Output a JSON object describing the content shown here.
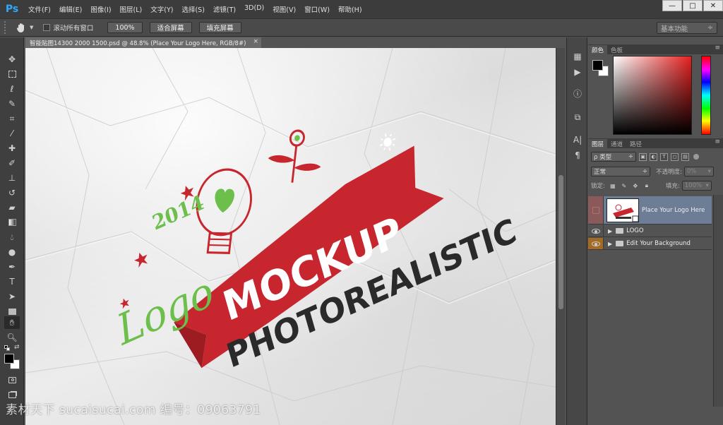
{
  "app": {
    "logo": "Ps",
    "menu": [
      "文件(F)",
      "编辑(E)",
      "图像(I)",
      "图层(L)",
      "文字(Y)",
      "选择(S)",
      "滤镜(T)",
      "3D(D)",
      "视图(V)",
      "窗口(W)",
      "帮助(H)"
    ],
    "window_controls": [
      "—",
      "□",
      "✕"
    ]
  },
  "options_bar": {
    "scroll_all_label": "滚动所有窗口",
    "zoom_100": "100%",
    "fit_screen": "适合屏幕",
    "fill_screen": "填充屏幕",
    "workspace": "基本功能"
  },
  "document": {
    "tab_title": "智能贴图14300 2000 1500.psd @ 48.8% (Place Your Logo Here, RGB/8#)",
    "close": "×",
    "artwork": {
      "year": "2014",
      "script_word": "Logo",
      "banner_word": "MOCKUP",
      "tagline": "PHOTOREALISTIC",
      "colors": {
        "red": "#c8262e",
        "green": "#6cbf4a",
        "dark": "#2a2a2a"
      }
    }
  },
  "panels": {
    "color_tabs": [
      "颜色",
      "色板"
    ],
    "layers_tabs": [
      "图层",
      "通道",
      "路径"
    ],
    "filter_kind": "ρ 类型",
    "blend_mode": "正常",
    "opacity_label": "不透明度:",
    "opacity_value": "0%",
    "lock_label": "锁定:",
    "fill_label": "填充:",
    "fill_value": "100%",
    "layers": [
      {
        "name": "Place Your Logo Here",
        "type": "smart-object",
        "selected": true
      },
      {
        "name": "LOGO",
        "type": "group"
      },
      {
        "name": "Edit Your Background",
        "type": "group"
      }
    ]
  },
  "watermark": "素材天下 sucaisucai.com  编号：09063791"
}
